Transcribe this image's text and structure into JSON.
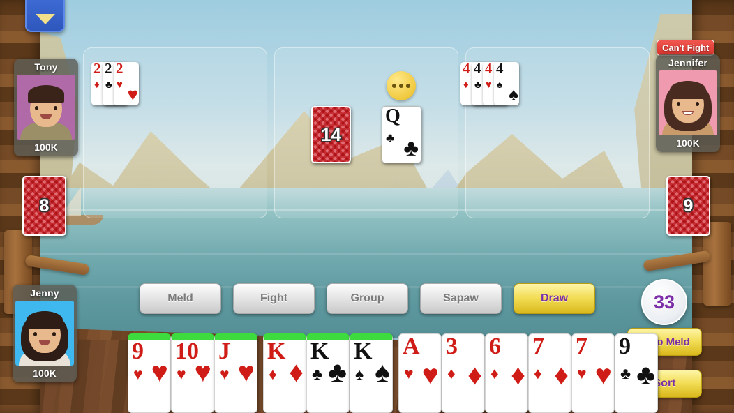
{
  "menu": {
    "icon": "chevron-down-icon"
  },
  "players": [
    {
      "id": "tony",
      "name": "Tony",
      "chips": "100K",
      "avatar_bg": "#b06aa8",
      "hair": "#3a2419",
      "shirt": "#9a8f66"
    },
    {
      "id": "jennifer",
      "name": "Jennifer",
      "chips": "100K",
      "avatar_bg": "#f09ab0",
      "hair": "#4a2b20",
      "shirt": "#c99a6a",
      "badge": "Can't Fight"
    },
    {
      "id": "jenny",
      "name": "Jenny",
      "chips": "100K",
      "avatar_bg": "#3fb8ef",
      "hair": "#2e1d16",
      "shirt": "#e8e2d8"
    }
  ],
  "melds": [
    {
      "panel": 0,
      "cards": [
        {
          "rank": "2",
          "suit": "♦",
          "color": "red"
        },
        {
          "rank": "2",
          "suit": "♣",
          "color": "black"
        },
        {
          "rank": "2",
          "suit": "♥",
          "color": "red"
        }
      ]
    },
    {
      "panel": 2,
      "cards": [
        {
          "rank": "4",
          "suit": "♦",
          "color": "red"
        },
        {
          "rank": "4",
          "suit": "♣",
          "color": "black"
        },
        {
          "rank": "4",
          "suit": "♥",
          "color": "red"
        },
        {
          "rank": "4",
          "suit": "♠",
          "color": "black"
        }
      ]
    }
  ],
  "center": {
    "draw_pile_count": "14",
    "discard": {
      "rank": "Q",
      "suit": "♣",
      "color": "black"
    },
    "thinking_indicator": "ellipsis-icon"
  },
  "side_piles": {
    "left_count": "8",
    "right_count": "9"
  },
  "actions": [
    {
      "label": "Meld",
      "style": "grey"
    },
    {
      "label": "Fight",
      "style": "grey"
    },
    {
      "label": "Group",
      "style": "grey"
    },
    {
      "label": "Sapaw",
      "style": "grey"
    },
    {
      "label": "Draw",
      "style": "gold"
    }
  ],
  "score": "33",
  "auto_meld_label": "Auto Meld",
  "sort_label": "Sort",
  "hand": [
    {
      "rank": "9",
      "suit": "♥",
      "color": "red",
      "grouped": true
    },
    {
      "rank": "10",
      "suit": "♥",
      "color": "red",
      "grouped": true
    },
    {
      "rank": "J",
      "suit": "♥",
      "color": "red",
      "grouped": true
    },
    {
      "gap": true
    },
    {
      "rank": "K",
      "suit": "♦",
      "color": "red",
      "grouped": true
    },
    {
      "rank": "K",
      "suit": "♣",
      "color": "black",
      "grouped": true
    },
    {
      "rank": "K",
      "suit": "♠",
      "color": "black",
      "grouped": true
    },
    {
      "gap": true
    },
    {
      "rank": "A",
      "suit": "♥",
      "color": "red",
      "grouped": false
    },
    {
      "rank": "3",
      "suit": "♦",
      "color": "red",
      "grouped": false
    },
    {
      "rank": "6",
      "suit": "♦",
      "color": "red",
      "grouped": false
    },
    {
      "rank": "7",
      "suit": "♦",
      "color": "red",
      "grouped": false
    },
    {
      "rank": "7",
      "suit": "♥",
      "color": "red",
      "grouped": false
    },
    {
      "rank": "9",
      "suit": "♣",
      "color": "black",
      "grouped": false
    }
  ],
  "colors": {
    "accent_gold": "#f2dd55",
    "accent_purple": "#7d2fa8",
    "group_green": "#3ddb3d",
    "danger_red": "#d8342c"
  }
}
